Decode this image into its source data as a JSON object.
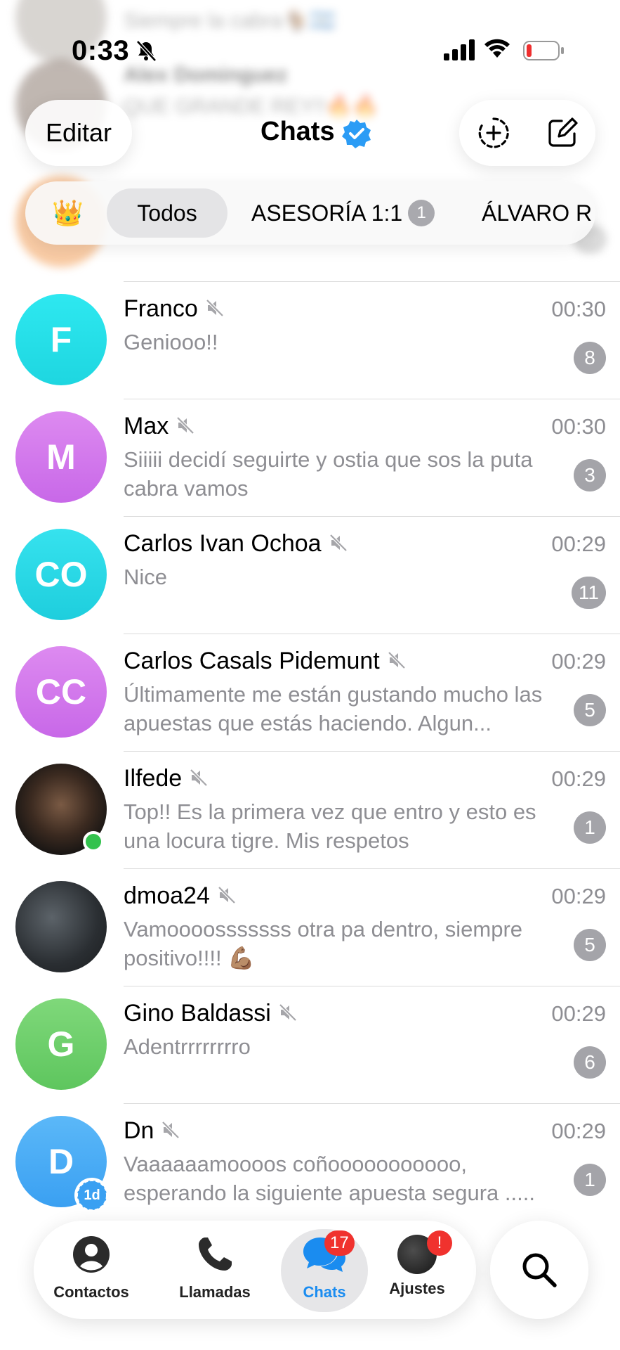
{
  "status_bar": {
    "time": "0:33"
  },
  "header": {
    "edit_label": "Editar",
    "title": "Chats"
  },
  "filters": {
    "crown": "👑",
    "tabs": [
      {
        "label": "Todos",
        "active": true
      },
      {
        "label": "ASESORÍA 1:1",
        "count": "1"
      },
      {
        "label": "ÁLVARO R"
      }
    ]
  },
  "ghost_rows": [
    {
      "text": "Siempre la cabra🐐🇦🇷"
    },
    {
      "text": "Alex Dominguez"
    },
    {
      "text": "QUE GRANDE REY!!🔥🔥"
    },
    {
      "text": "13"
    }
  ],
  "chats": [
    {
      "name": "Franco",
      "time": "00:30",
      "message": "Geniooo!!",
      "badge": "8",
      "avatar_text": "F",
      "avatar_color": "#1ed6e0",
      "avatar_color2": "#2ee8f0"
    },
    {
      "name": "Max",
      "time": "00:30",
      "message": "Siiiii decidí seguirte y ostia que sos la puta cabra vamos",
      "badge": "3",
      "avatar_text": "M",
      "avatar_color": "#c868e8",
      "avatar_color2": "#dd8af0"
    },
    {
      "name": "Carlos Ivan Ochoa",
      "time": "00:29",
      "message": "Nice",
      "badge": "11",
      "avatar_text": "CO",
      "avatar_color": "#1ecedd",
      "avatar_color2": "#36e2ee"
    },
    {
      "name": "Carlos Casals Pidemunt",
      "time": "00:29",
      "message": "Últimamente me están gustando mucho las apuestas que estás haciendo. Algun...",
      "badge": "5",
      "avatar_text": "CC",
      "avatar_color": "#c868e8",
      "avatar_color2": "#dd8af0"
    },
    {
      "name": "Ilfede",
      "time": "00:29",
      "message": "Top!! Es la primera vez que entro y esto es una locura tigre. Mis respetos",
      "badge": "1",
      "avatar_text": "",
      "avatar_color": "#2a241f",
      "avatar_color2": "#6b5442"
    },
    {
      "name": "dmoa24",
      "time": "00:29",
      "message": "Vamoooosssssss otra pa dentro, siempre positivo!!!! 💪🏽",
      "badge": "5",
      "avatar_text": "",
      "avatar_color": "#2b2f33",
      "avatar_color2": "#4a5057"
    },
    {
      "name": "Gino Baldassi",
      "time": "00:29",
      "message": "Adentrrrrrrrro",
      "badge": "6",
      "avatar_text": "G",
      "avatar_color": "#5ec65e",
      "avatar_color2": "#7fd87a"
    },
    {
      "name": "Dn",
      "time": "00:29",
      "message": "Vaaaaaamoooos coñooooooooooo, esperando la siguiente apuesta segura .....",
      "badge": "1",
      "avatar_text": "D",
      "avatar_color": "#3aa0f2",
      "avatar_color2": "#5bb8f8",
      "story_label": "1d"
    }
  ],
  "tabbar": {
    "items": [
      {
        "label": "Contactos",
        "icon": "person-circle-icon"
      },
      {
        "label": "Llamadas",
        "icon": "phone-icon"
      },
      {
        "label": "Chats",
        "icon": "chat-bubbles-icon",
        "badge": "17",
        "active": true
      },
      {
        "label": "Ajustes",
        "icon": "avatar-icon",
        "badge": "!"
      }
    ],
    "accent": "#1a8cf0",
    "badge_color": "#f0322e"
  },
  "search_icon": "search-icon"
}
